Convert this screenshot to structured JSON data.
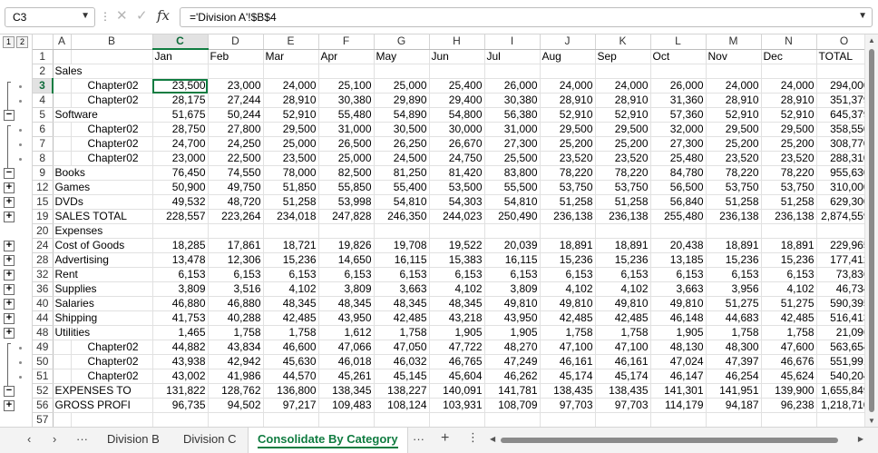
{
  "formula_bar": {
    "name_box": "C3",
    "cancel_icon": "✕",
    "enter_icon": "✓",
    "fx_label": "fx",
    "formula": "='Division A'!$B$4"
  },
  "outline": {
    "level1": "1",
    "level2": "2"
  },
  "columns": [
    "A",
    "B",
    "C",
    "D",
    "E",
    "F",
    "G",
    "H",
    "I",
    "J",
    "K",
    "L",
    "M",
    "N",
    "O"
  ],
  "rows": [
    {
      "num": "1",
      "a": "",
      "b": "",
      "v": [
        "Jan",
        "Feb",
        "Mar",
        "Apr",
        "May",
        "Jun",
        "Jul",
        "Aug",
        "Sep",
        "Oct",
        "Nov",
        "Dec",
        "TOTAL"
      ]
    },
    {
      "num": "2",
      "a": "Sales",
      "b": "",
      "v": [
        "",
        "",
        "",
        "",
        "",
        "",
        "",
        "",
        "",
        "",
        "",
        "",
        ""
      ]
    },
    {
      "num": "3",
      "a": "",
      "b": "Chapter02",
      "v": [
        "23,500",
        "23,000",
        "24,000",
        "25,100",
        "25,000",
        "25,400",
        "26,000",
        "24,000",
        "24,000",
        "26,000",
        "24,000",
        "24,000",
        "294,000"
      ]
    },
    {
      "num": "4",
      "a": "",
      "b": "Chapter02",
      "v": [
        "28,175",
        "27,244",
        "28,910",
        "30,380",
        "29,890",
        "29,400",
        "30,380",
        "28,910",
        "28,910",
        "31,360",
        "28,910",
        "28,910",
        "351,379"
      ]
    },
    {
      "num": "5",
      "a": "Software",
      "b": "",
      "v": [
        "51,675",
        "50,244",
        "52,910",
        "55,480",
        "54,890",
        "54,800",
        "56,380",
        "52,910",
        "52,910",
        "57,360",
        "52,910",
        "52,910",
        "645,379"
      ]
    },
    {
      "num": "6",
      "a": "",
      "b": "Chapter02",
      "v": [
        "28,750",
        "27,800",
        "29,500",
        "31,000",
        "30,500",
        "30,000",
        "31,000",
        "29,500",
        "29,500",
        "32,000",
        "29,500",
        "29,500",
        "358,550"
      ]
    },
    {
      "num": "7",
      "a": "",
      "b": "Chapter02",
      "v": [
        "24,700",
        "24,250",
        "25,000",
        "26,500",
        "26,250",
        "26,670",
        "27,300",
        "25,200",
        "25,200",
        "27,300",
        "25,200",
        "25,200",
        "308,770"
      ]
    },
    {
      "num": "8",
      "a": "",
      "b": "Chapter02",
      "v": [
        "23,000",
        "22,500",
        "23,500",
        "25,000",
        "24,500",
        "24,750",
        "25,500",
        "23,520",
        "23,520",
        "25,480",
        "23,520",
        "23,520",
        "288,310"
      ]
    },
    {
      "num": "9",
      "a": "Books",
      "b": "",
      "v": [
        "76,450",
        "74,550",
        "78,000",
        "82,500",
        "81,250",
        "81,420",
        "83,800",
        "78,220",
        "78,220",
        "84,780",
        "78,220",
        "78,220",
        "955,630"
      ]
    },
    {
      "num": "12",
      "a": "Games",
      "b": "",
      "v": [
        "50,900",
        "49,750",
        "51,850",
        "55,850",
        "55,400",
        "53,500",
        "55,500",
        "53,750",
        "53,750",
        "56,500",
        "53,750",
        "53,750",
        "310,000"
      ]
    },
    {
      "num": "15",
      "a": "DVDs",
      "b": "",
      "v": [
        "49,532",
        "48,720",
        "51,258",
        "53,998",
        "54,810",
        "54,303",
        "54,810",
        "51,258",
        "51,258",
        "56,840",
        "51,258",
        "51,258",
        "629,300"
      ]
    },
    {
      "num": "19",
      "a": "SALES TOTAL",
      "b": "",
      "v": [
        "228,557",
        "223,264",
        "234,018",
        "247,828",
        "246,350",
        "244,023",
        "250,490",
        "236,138",
        "236,138",
        "255,480",
        "236,138",
        "236,138",
        "2,874,559"
      ]
    },
    {
      "num": "20",
      "a": "Expenses",
      "b": "",
      "v": [
        "",
        "",
        "",
        "",
        "",
        "",
        "",
        "",
        "",
        "",
        "",
        "",
        ""
      ]
    },
    {
      "num": "24",
      "a": "Cost of Goods",
      "b": "",
      "v": [
        "18,285",
        "17,861",
        "18,721",
        "19,826",
        "19,708",
        "19,522",
        "20,039",
        "18,891",
        "18,891",
        "20,438",
        "18,891",
        "18,891",
        "229,965"
      ]
    },
    {
      "num": "28",
      "a": "Advertising",
      "b": "",
      "v": [
        "13,478",
        "12,306",
        "15,236",
        "14,650",
        "16,115",
        "15,383",
        "16,115",
        "15,236",
        "15,236",
        "13,185",
        "15,236",
        "15,236",
        "177,412"
      ]
    },
    {
      "num": "32",
      "a": "Rent",
      "b": "",
      "v": [
        "6,153",
        "6,153",
        "6,153",
        "6,153",
        "6,153",
        "6,153",
        "6,153",
        "6,153",
        "6,153",
        "6,153",
        "6,153",
        "6,153",
        "73,836"
      ]
    },
    {
      "num": "36",
      "a": "Supplies",
      "b": "",
      "v": [
        "3,809",
        "3,516",
        "4,102",
        "3,809",
        "3,663",
        "4,102",
        "3,809",
        "4,102",
        "4,102",
        "3,663",
        "3,956",
        "4,102",
        "46,734"
      ]
    },
    {
      "num": "40",
      "a": "Salaries",
      "b": "",
      "v": [
        "46,880",
        "46,880",
        "48,345",
        "48,345",
        "48,345",
        "48,345",
        "49,810",
        "49,810",
        "49,810",
        "49,810",
        "51,275",
        "51,275",
        "590,395"
      ]
    },
    {
      "num": "44",
      "a": "Shipping",
      "b": "",
      "v": [
        "41,753",
        "40,288",
        "42,485",
        "43,950",
        "42,485",
        "43,218",
        "43,950",
        "42,485",
        "42,485",
        "46,148",
        "44,683",
        "42,485",
        "516,413"
      ]
    },
    {
      "num": "48",
      "a": "Utilities",
      "b": "",
      "v": [
        "1,465",
        "1,758",
        "1,758",
        "1,612",
        "1,758",
        "1,905",
        "1,905",
        "1,758",
        "1,758",
        "1,905",
        "1,758",
        "1,758",
        "21,096"
      ]
    },
    {
      "num": "49",
      "a": "",
      "b": "Chapter02",
      "v": [
        "44,882",
        "43,834",
        "46,600",
        "47,066",
        "47,050",
        "47,722",
        "48,270",
        "47,100",
        "47,100",
        "48,130",
        "48,300",
        "47,600",
        "563,654"
      ]
    },
    {
      "num": "50",
      "a": "",
      "b": "Chapter02",
      "v": [
        "43,938",
        "42,942",
        "45,630",
        "46,018",
        "46,032",
        "46,765",
        "47,249",
        "46,161",
        "46,161",
        "47,024",
        "47,397",
        "46,676",
        "551,991"
      ]
    },
    {
      "num": "51",
      "a": "",
      "b": "Chapter02",
      "v": [
        "43,002",
        "41,986",
        "44,570",
        "45,261",
        "45,145",
        "45,604",
        "46,262",
        "45,174",
        "45,174",
        "46,147",
        "46,254",
        "45,624",
        "540,204"
      ]
    },
    {
      "num": "52",
      "a": "EXPENSES TO",
      "b": "",
      "v": [
        "131,822",
        "128,762",
        "136,800",
        "138,345",
        "138,227",
        "140,091",
        "141,781",
        "138,435",
        "138,435",
        "141,301",
        "141,951",
        "139,900",
        "1,655,849"
      ]
    },
    {
      "num": "56",
      "a": "GROSS PROFI",
      "b": "",
      "v": [
        "96,735",
        "94,502",
        "97,217",
        "109,483",
        "108,124",
        "103,931",
        "108,709",
        "97,703",
        "97,703",
        "114,179",
        "94,187",
        "96,238",
        "1,218,710"
      ]
    },
    {
      "num": "57",
      "a": "",
      "b": "",
      "v": [
        "",
        "",
        "",
        "",
        "",
        "",
        "",
        "",
        "",
        "",
        "",
        "",
        ""
      ]
    }
  ],
  "tabs": {
    "nav_prev": "‹",
    "nav_next": "›",
    "more_left": "···",
    "sheets": [
      "Division B",
      "Division C",
      "Consolidate By Category"
    ],
    "active_sheet": "Consolidate By Category",
    "more_right": "···",
    "add_label": "+"
  },
  "colors": {
    "accent": "#107c41"
  }
}
